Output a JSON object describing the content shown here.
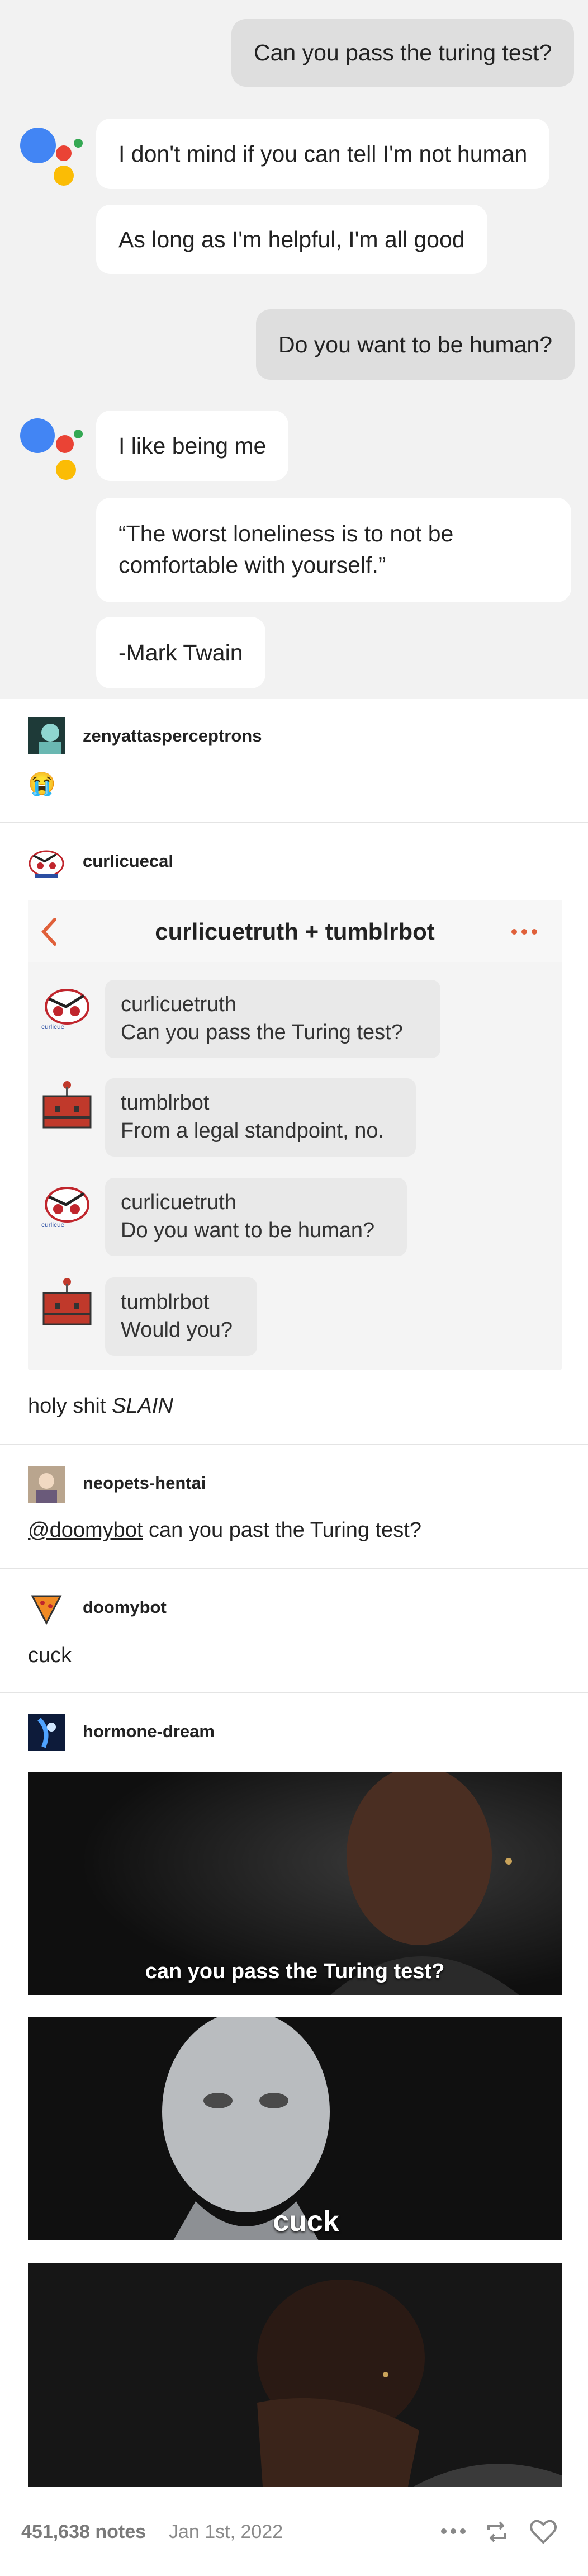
{
  "assistant": {
    "messages": [
      {
        "role": "user",
        "text": "Can you pass the turing test?"
      },
      {
        "role": "bot",
        "text": "I don't mind if you can tell I'm not human"
      },
      {
        "role": "bot",
        "text": "As long as I'm helpful, I'm all good"
      },
      {
        "role": "user",
        "text": "Do you want to be human?"
      },
      {
        "role": "bot",
        "text": "I like being me"
      },
      {
        "role": "bot",
        "text": "“The worst loneliness is to not be comfortable with yourself.”"
      },
      {
        "role": "bot",
        "text": "-Mark Twain"
      }
    ],
    "colors": {
      "blue": "#4285f4",
      "red": "#ea4335",
      "yellow": "#fbbc05",
      "green": "#34a853"
    }
  },
  "posts": [
    {
      "username": "zenyattasperceptrons",
      "body": "😭"
    },
    {
      "username": "curlicuecal",
      "body_plain": "holy shit ",
      "body_em": "SLAIN"
    },
    {
      "username": "neopets-hentai",
      "mention": "@doomybot",
      "body": " can you past the Turing test?"
    },
    {
      "username": "doomybot",
      "body": "cuck"
    },
    {
      "username": "hormone-dream"
    }
  ],
  "embed": {
    "title": "curlicuetruth + tumblrbot",
    "messages": [
      {
        "name": "curlicuetruth",
        "text": "Can you pass the Turing test?"
      },
      {
        "name": "tumblrbot",
        "text": "From a legal standpoint, no."
      },
      {
        "name": "curlicuetruth",
        "text": "Do you want to be human?"
      },
      {
        "name": "tumblrbot",
        "text": "Would you?"
      }
    ],
    "accent": "#e0603a"
  },
  "meme": {
    "captions": [
      "can you pass the Turing test?",
      "cuck"
    ]
  },
  "footer": {
    "notes": "451,638 notes",
    "date": "Jan 1st, 2022"
  }
}
